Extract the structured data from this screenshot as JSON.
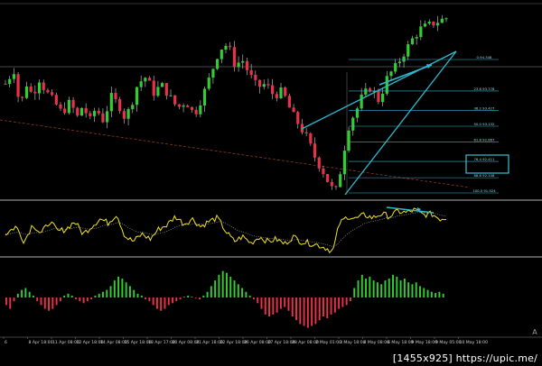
{
  "chart_data": [
    {
      "type": "candlestick",
      "panel": "price",
      "colors": {
        "bull": "#33cc33",
        "bear": "#e8324a",
        "background": "#000000",
        "trendline": "#2fb9cf",
        "fib": "#2fb9cf",
        "highlight_box": "#3ad3e0",
        "long_trend": "#8a3a1f",
        "hline": "#8f8f8f"
      },
      "price_path": [
        [
          0,
          0.62
        ],
        [
          4,
          0.7
        ],
        [
          7,
          0.48
        ],
        [
          10,
          0.62
        ],
        [
          13,
          0.55
        ],
        [
          16,
          0.65
        ],
        [
          19,
          0.58
        ],
        [
          23,
          0.52
        ],
        [
          27,
          0.45
        ],
        [
          31,
          0.52
        ],
        [
          34,
          0.42
        ],
        [
          37,
          0.5
        ],
        [
          40,
          0.4
        ],
        [
          43,
          0.48
        ],
        [
          47,
          0.4
        ],
        [
          50,
          0.55
        ],
        [
          54,
          0.5
        ],
        [
          57,
          0.42
        ],
        [
          60,
          0.5
        ],
        [
          63,
          0.62
        ],
        [
          67,
          0.66
        ],
        [
          71,
          0.56
        ],
        [
          74,
          0.62
        ],
        [
          78,
          0.55
        ],
        [
          82,
          0.48
        ],
        [
          86,
          0.52
        ],
        [
          90,
          0.44
        ],
        [
          94,
          0.55
        ],
        [
          98,
          0.68
        ],
        [
          102,
          0.82
        ],
        [
          106,
          0.85
        ],
        [
          110,
          0.7
        ],
        [
          112,
          0.78
        ],
        [
          116,
          0.68
        ],
        [
          120,
          0.6
        ],
        [
          124,
          0.62
        ],
        [
          128,
          0.55
        ],
        [
          132,
          0.58
        ],
        [
          136,
          0.46
        ],
        [
          140,
          0.38
        ],
        [
          144,
          0.3
        ],
        [
          148,
          0.18
        ],
        [
          152,
          0.1
        ],
        [
          155,
          0.02
        ],
        [
          158,
          0.0
        ],
        [
          161,
          0.22
        ],
        [
          164,
          0.4
        ],
        [
          167,
          0.46
        ],
        [
          170,
          0.55
        ],
        [
          174,
          0.6
        ],
        [
          178,
          0.52
        ],
        [
          182,
          0.66
        ],
        [
          186,
          0.72
        ],
        [
          190,
          0.8
        ],
        [
          194,
          0.88
        ],
        [
          198,
          0.94
        ],
        [
          202,
          0.96
        ],
        [
          206,
          0.98
        ],
        [
          210,
          1.0
        ]
      ],
      "fib_levels": [
        {
          "label": "0.94.348"
        },
        {
          "label": "23.6 93.778"
        },
        {
          "label": "38.2 93.427"
        },
        {
          "label": "50.0 93.132"
        },
        {
          "label": "61.8 92.867"
        },
        {
          "label": "76.4 92.411"
        },
        {
          "label": "88.6 92.108"
        },
        {
          "label": "100.0 91.924"
        }
      ],
      "fib_ratios": [
        0,
        0.236,
        0.382,
        0.5,
        0.618,
        0.764,
        0.886,
        1.0
      ]
    },
    {
      "type": "line",
      "panel": "oscillator",
      "series": [
        {
          "color": "#f2e422",
          "style": "solid"
        },
        {
          "color": "#b8b8b8",
          "style": "dotted"
        }
      ],
      "path": [
        [
          0,
          0.4
        ],
        [
          5,
          0.55
        ],
        [
          9,
          0.25
        ],
        [
          13,
          0.6
        ],
        [
          17,
          0.4
        ],
        [
          21,
          0.65
        ],
        [
          25,
          0.45
        ],
        [
          29,
          0.5
        ],
        [
          33,
          0.65
        ],
        [
          37,
          0.4
        ],
        [
          41,
          0.55
        ],
        [
          45,
          0.7
        ],
        [
          49,
          0.62
        ],
        [
          53,
          0.8
        ],
        [
          57,
          0.35
        ],
        [
          61,
          0.25
        ],
        [
          65,
          0.4
        ],
        [
          69,
          0.3
        ],
        [
          73,
          0.5
        ],
        [
          77,
          0.58
        ],
        [
          81,
          0.75
        ],
        [
          85,
          0.6
        ],
        [
          89,
          0.7
        ],
        [
          93,
          0.55
        ],
        [
          97,
          0.65
        ],
        [
          101,
          0.72
        ],
        [
          105,
          0.45
        ],
        [
          109,
          0.25
        ],
        [
          113,
          0.35
        ],
        [
          117,
          0.22
        ],
        [
          121,
          0.35
        ],
        [
          125,
          0.25
        ],
        [
          129,
          0.3
        ],
        [
          133,
          0.2
        ],
        [
          137,
          0.35
        ],
        [
          141,
          0.25
        ],
        [
          145,
          0.22
        ],
        [
          149,
          0.18
        ],
        [
          153,
          0.12
        ],
        [
          156,
          0.05
        ],
        [
          159,
          0.6
        ],
        [
          163,
          0.75
        ],
        [
          167,
          0.7
        ],
        [
          171,
          0.78
        ],
        [
          175,
          0.72
        ],
        [
          179,
          0.8
        ],
        [
          183,
          0.75
        ],
        [
          187,
          0.85
        ],
        [
          191,
          0.82
        ],
        [
          195,
          0.88
        ],
        [
          199,
          0.78
        ],
        [
          203,
          0.8
        ],
        [
          207,
          0.7
        ],
        [
          210,
          0.72
        ]
      ]
    },
    {
      "type": "bar",
      "panel": "histogram",
      "colors": {
        "positive": "#33cc33",
        "negative": "#e8324a"
      },
      "values": [
        -0.2,
        -0.3,
        -0.1,
        0.1,
        0.2,
        0.25,
        0.15,
        0.05,
        -0.1,
        -0.2,
        -0.3,
        -0.35,
        -0.3,
        -0.2,
        -0.1,
        0.05,
        0.1,
        0.05,
        -0.05,
        -0.1,
        -0.15,
        -0.1,
        -0.05,
        0.05,
        0.1,
        0.15,
        0.2,
        0.3,
        0.45,
        0.55,
        0.5,
        0.4,
        0.3,
        0.2,
        0.1,
        0.05,
        -0.05,
        -0.1,
        -0.2,
        -0.3,
        -0.35,
        -0.3,
        -0.2,
        -0.15,
        -0.1,
        -0.05,
        0.02,
        0.05,
        0.02,
        -0.02,
        -0.05,
        0.05,
        0.15,
        0.3,
        0.45,
        0.6,
        0.7,
        0.65,
        0.55,
        0.45,
        0.35,
        0.25,
        0.15,
        0.05,
        -0.05,
        -0.15,
        -0.3,
        -0.45,
        -0.5,
        -0.45,
        -0.4,
        -0.3,
        -0.25,
        -0.35,
        -0.5,
        -0.6,
        -0.7,
        -0.75,
        -0.8,
        -0.75,
        -0.7,
        -0.6,
        -0.5,
        -0.55,
        -0.45,
        -0.4,
        -0.3,
        -0.25,
        -0.2,
        -0.1,
        0.25,
        0.45,
        0.6,
        0.5,
        0.55,
        0.45,
        0.4,
        0.35,
        0.45,
        0.5,
        0.6,
        0.55,
        0.45,
        0.5,
        0.4,
        0.35,
        0.4,
        0.3,
        0.25,
        0.2,
        0.15,
        0.12,
        0.15,
        0.1
      ],
      "gaps_after": [],
      "x_tick_labels": [
        "6",
        "8 Apr 18:00",
        "11 Apr 08:00",
        "12 Apr 18:00",
        "14 Apr 08:00",
        "15 Apr 18:00",
        "18 Apr 17:00",
        "20 Apr 08:00",
        "21 Apr 18:00",
        "22 Apr 18:00",
        "26 Apr 08:00",
        "27 Apr 18:00",
        "28 Apr 08:00",
        "2 May 01:00",
        "3 May 18:00",
        "4 May 08:00",
        "6 May 18:00",
        "9 May 18:00",
        "9 May 05:00",
        "10 May 18:00"
      ],
      "corner_label": "A"
    }
  ],
  "watermark": "[1455x925] https://upic.me/"
}
